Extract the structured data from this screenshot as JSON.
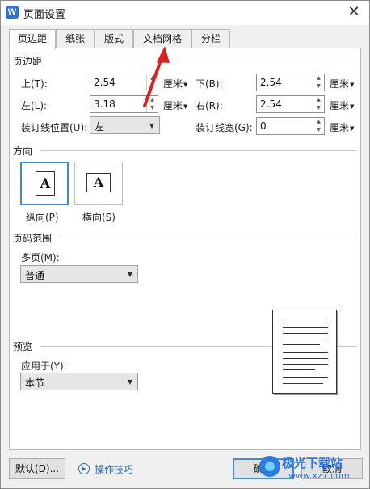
{
  "window": {
    "title": "页面设置",
    "app_icon_letter": "W",
    "close_glyph": "✕"
  },
  "tabs": [
    {
      "label": "页边距",
      "active": true
    },
    {
      "label": "纸张",
      "active": false
    },
    {
      "label": "版式",
      "active": false
    },
    {
      "label": "文档网格",
      "active": false
    },
    {
      "label": "分栏",
      "active": false
    }
  ],
  "margins": {
    "section_title": "页边距",
    "top": {
      "label": "上(T):",
      "value": "2.54",
      "unit": "厘米"
    },
    "bottom": {
      "label": "下(B):",
      "value": "2.54",
      "unit": "厘米"
    },
    "left": {
      "label": "左(L):",
      "value": "3.18",
      "unit": "厘米"
    },
    "right": {
      "label": "右(R):",
      "value": "2.54",
      "unit": "厘米"
    },
    "gutter_position": {
      "label": "装订线位置(U):",
      "value": "左"
    },
    "gutter_width": {
      "label": "装订线宽(G):",
      "value": "0",
      "unit": "厘米"
    }
  },
  "orientation": {
    "section_title": "方向",
    "portrait": {
      "label": "纵向(P)",
      "glyph": "A",
      "selected": true
    },
    "landscape": {
      "label": "横向(S)",
      "glyph": "A",
      "selected": false
    }
  },
  "page_range": {
    "section_title": "页码范围",
    "multiple_pages": {
      "label": "多页(M):",
      "value": "普通"
    }
  },
  "preview": {
    "section_title": "预览",
    "apply_to": {
      "label": "应用于(Y):",
      "value": "本节"
    }
  },
  "footer": {
    "default_button": "默认(D)...",
    "help_link": "操作技巧",
    "ok_button": "确定",
    "cancel_button": "取消"
  },
  "watermark": {
    "text": "极光下载站",
    "url": "www.xz7.com"
  },
  "colors": {
    "accent": "#3b8be0",
    "arrow": "#e02020",
    "link": "#2a6fc4"
  }
}
